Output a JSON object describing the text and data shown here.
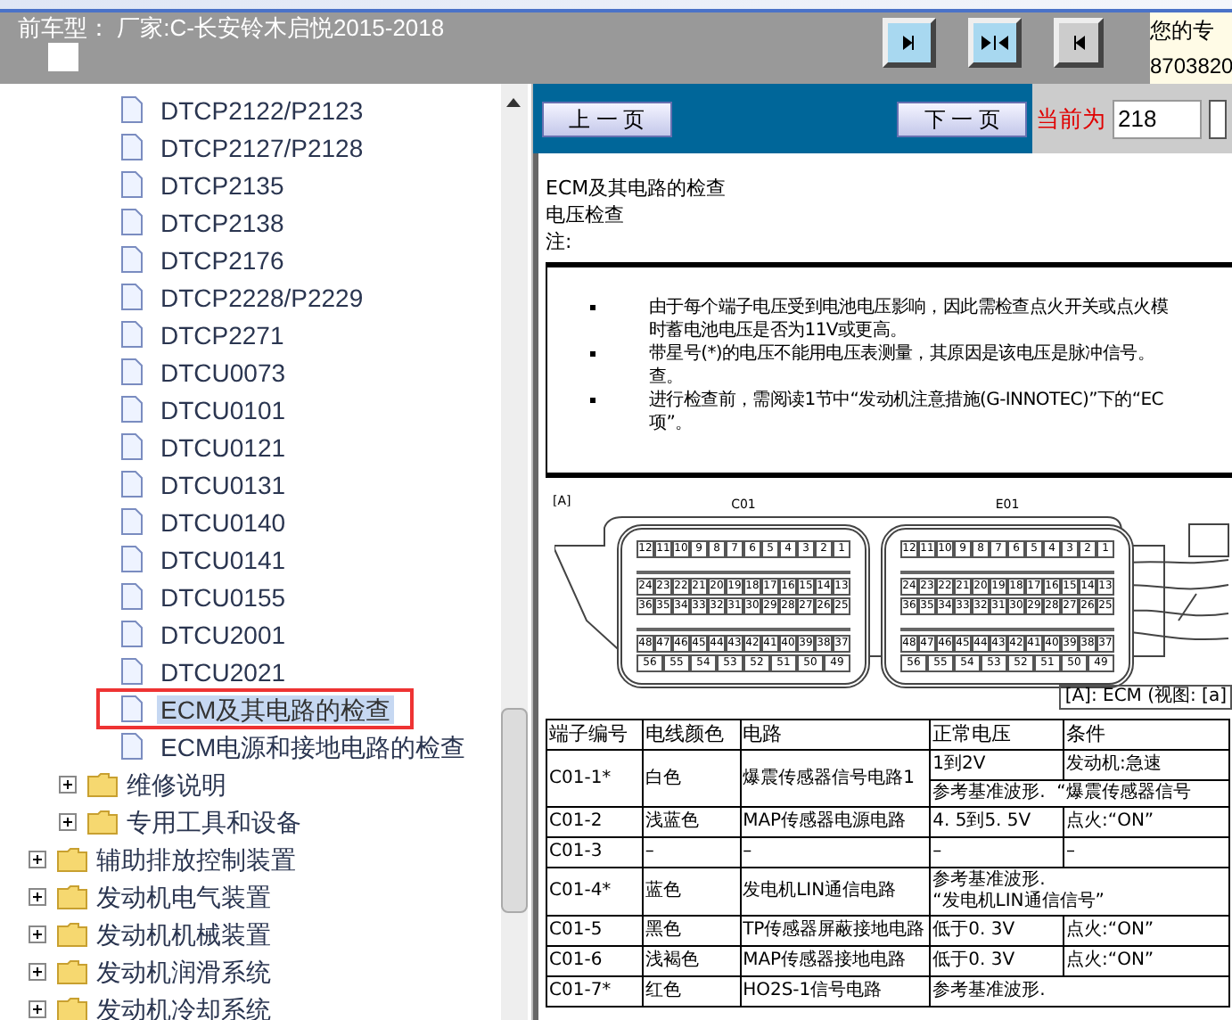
{
  "header": {
    "title": "前车型： 厂家:C-长安铃木启悦2015-2018",
    "side_lines": [
      "您的专",
      "8703820"
    ]
  },
  "tree": [
    {
      "children": [
        {
          "children": [
            {
              "label": "DTCP2122/P2123",
              "kind": "page",
              "selected": false
            },
            {
              "label": "DTCP2127/P2128",
              "kind": "page",
              "selected": false
            },
            {
              "label": "DTCP2135",
              "kind": "page",
              "selected": false
            },
            {
              "label": "DTCP2138",
              "kind": "page",
              "selected": false
            },
            {
              "label": "DTCP2176",
              "kind": "page",
              "selected": false
            },
            {
              "label": "DTCP2228/P2229",
              "kind": "page",
              "selected": false
            },
            {
              "label": "DTCP2271",
              "kind": "page",
              "selected": false
            },
            {
              "label": "DTCU0073",
              "kind": "page",
              "selected": false
            },
            {
              "label": "DTCU0101",
              "kind": "page",
              "selected": false
            },
            {
              "label": "DTCU0121",
              "kind": "page",
              "selected": false
            },
            {
              "label": "DTCU0131",
              "kind": "page",
              "selected": false
            },
            {
              "label": "DTCU0140",
              "kind": "page",
              "selected": false
            },
            {
              "label": "DTCU0141",
              "kind": "page",
              "selected": false
            },
            {
              "label": "DTCU0155",
              "kind": "page",
              "selected": false
            },
            {
              "label": "DTCU2001",
              "kind": "page",
              "selected": false
            },
            {
              "label": "DTCU2021",
              "kind": "page",
              "selected": false
            },
            {
              "label": "ECM及其电路的检查",
              "kind": "page",
              "selected": true
            },
            {
              "label": "ECM电源和接地电路的检查",
              "kind": "page",
              "selected": false
            }
          ]
        },
        {
          "label": "维修说明",
          "kind": "folder",
          "expanded": false
        },
        {
          "label": "专用工具和设备",
          "kind": "folder",
          "expanded": false
        }
      ]
    },
    {
      "label": "辅助排放控制装置",
      "kind": "folder",
      "expanded": false
    },
    {
      "label": "发动机电气装置",
      "kind": "folder",
      "expanded": false
    },
    {
      "label": "发动机机械装置",
      "kind": "folder",
      "expanded": false
    },
    {
      "label": "发动机润滑系统",
      "kind": "folder",
      "expanded": false
    },
    {
      "label": "发动机冷却系统",
      "kind": "folder",
      "expanded": false
    }
  ],
  "pager": {
    "prev": "上 一 页",
    "next": "下 一 页",
    "current_label": "当前为",
    "current_value": "218"
  },
  "document": {
    "headings": [
      "ECM及其电路的检查",
      "电压检查",
      "注:"
    ],
    "notes": [
      [
        "由于每个端子电压受到电池电压影响，因此需检查点火开关或点火模",
        "时蓄电池电压是否为11V或更高。"
      ],
      [
        "带星号(*)的电压不能用电压表测量，其原因是该电压是脉冲信号。",
        "查。"
      ],
      [
        "进行检查前，需阅读1节中“发动机注意措施(G-INNOTEC)”下的“EC",
        "项”。"
      ]
    ],
    "figure_tag": "[A]",
    "connectors": [
      {
        "label": "C01",
        "pin_rows": [
          [
            "12",
            "11",
            "10",
            "9",
            "8",
            "7",
            "6",
            "5",
            "4",
            "3",
            "2",
            "1"
          ],
          [
            "24",
            "23",
            "22",
            "21",
            "20",
            "19",
            "18",
            "17",
            "16",
            "15",
            "14",
            "13"
          ],
          [
            "36",
            "35",
            "34",
            "33",
            "32",
            "31",
            "30",
            "29",
            "28",
            "27",
            "26",
            "25"
          ],
          [
            "48",
            "47",
            "46",
            "45",
            "44",
            "43",
            "42",
            "41",
            "40",
            "39",
            "38",
            "37"
          ],
          [
            "56",
            "55",
            "54",
            "53",
            "52",
            "51",
            "50",
            "49"
          ]
        ]
      },
      {
        "label": "E01",
        "pin_rows": [
          [
            "12",
            "11",
            "10",
            "9",
            "8",
            "7",
            "6",
            "5",
            "4",
            "3",
            "2",
            "1"
          ],
          [
            "24",
            "23",
            "22",
            "21",
            "20",
            "19",
            "18",
            "17",
            "16",
            "15",
            "14",
            "13"
          ],
          [
            "36",
            "35",
            "34",
            "33",
            "32",
            "31",
            "30",
            "29",
            "28",
            "27",
            "26",
            "25"
          ],
          [
            "48",
            "47",
            "46",
            "45",
            "44",
            "43",
            "42",
            "41",
            "40",
            "39",
            "38",
            "37"
          ],
          [
            "56",
            "55",
            "54",
            "53",
            "52",
            "51",
            "50",
            "49"
          ]
        ]
      }
    ],
    "caption": "[A]: ECM (视图: [a]",
    "table": {
      "columns": [
        "端子编号",
        "电线颜色",
        "电路",
        "正常电压",
        "条件"
      ],
      "rows": [
        {
          "cells": [
            "C01-1*",
            "白色",
            "爆震传感器信号电路1",
            "1到2V",
            "发动机:急速"
          ],
          "note": [
            "参考基准波形.  “爆震传感器信号"
          ]
        },
        {
          "cells": [
            "C01-2",
            "浅蓝色",
            "MAP传感器电源电路",
            "4. 5到5. 5V",
            "点火:“ON”"
          ]
        },
        {
          "cells": [
            "C01-3",
            "–",
            "–",
            "–",
            "–"
          ]
        },
        {
          "cells": [
            "C01-4*",
            "蓝色",
            "发电机LIN通信电路"
          ],
          "note": [
            "参考基准波形.",
            "“发电机LIN通信信号”"
          ]
        },
        {
          "cells": [
            "C01-5",
            "黑色",
            "TP传感器屏蔽接地电路",
            "低于0. 3V",
            "点火:“ON”"
          ]
        },
        {
          "cells": [
            "C01-6",
            "浅褐色",
            "MAP传感器接地电路",
            "低于0. 3V",
            "点火:“ON”"
          ]
        },
        {
          "cells": [
            "C01-7*",
            "红色",
            "HO2S-1信号电路"
          ],
          "note": [
            "参考基准波形."
          ]
        }
      ]
    }
  }
}
